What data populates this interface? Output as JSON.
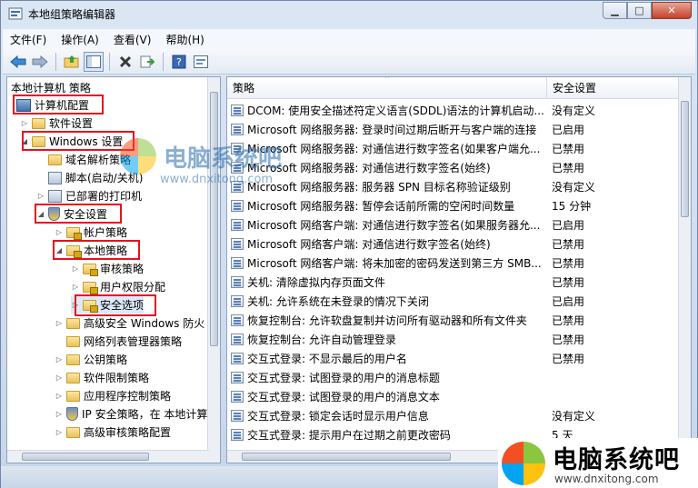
{
  "window": {
    "title": "本地组策略编辑器",
    "buttons": {
      "minimize": "▁",
      "maximize": "□",
      "close": "✕"
    }
  },
  "menu": [
    "文件(F)",
    "操作(A)",
    "查看(V)",
    "帮助(H)"
  ],
  "toolbar_icons": [
    "back-arrow-icon",
    "forward-arrow-icon",
    "up-folder-icon",
    "show-hide-tree-icon",
    "delete-icon",
    "export-list-icon",
    "help-icon",
    "properties-icon"
  ],
  "tree": {
    "root": "本地计算机 策略",
    "items": [
      {
        "label": "计算机配置",
        "level": 0,
        "icon": "computer-icon",
        "expanded": true,
        "highlight": true
      },
      {
        "label": "软件设置",
        "level": 1,
        "icon": "folder-icon",
        "expanded": false
      },
      {
        "label": "Windows 设置",
        "level": 1,
        "icon": "folder-icon",
        "expanded": true,
        "highlight": true
      },
      {
        "label": "域名解析策略",
        "level": 2,
        "icon": "folder-icon",
        "expanded": false
      },
      {
        "label": "脚本(启动/关机)",
        "level": 2,
        "icon": "script-icon",
        "expanded": null
      },
      {
        "label": "已部署的打印机",
        "level": 2,
        "icon": "printer-icon",
        "expanded": false
      },
      {
        "label": "安全设置",
        "level": 2,
        "icon": "security-icon",
        "expanded": true,
        "highlight": true
      },
      {
        "label": "帐户策略",
        "level": 3,
        "icon": "folder-icon",
        "expanded": false
      },
      {
        "label": "本地策略",
        "level": 3,
        "icon": "folder-icon",
        "expanded": true,
        "highlight": true
      },
      {
        "label": "审核策略",
        "level": 4,
        "icon": "folder-icon",
        "expanded": false
      },
      {
        "label": "用户权限分配",
        "level": 4,
        "icon": "folder-icon",
        "expanded": false
      },
      {
        "label": "安全选项",
        "level": 4,
        "icon": "folder-icon",
        "expanded": false,
        "highlight": true,
        "selected": true
      },
      {
        "label": "高级安全 Windows 防火",
        "level": 3,
        "icon": "folder-icon",
        "expanded": false
      },
      {
        "label": "网络列表管理器策略",
        "level": 3,
        "icon": "folder-icon",
        "expanded": null
      },
      {
        "label": "公钥策略",
        "level": 3,
        "icon": "folder-icon",
        "expanded": false
      },
      {
        "label": "软件限制策略",
        "level": 3,
        "icon": "folder-icon",
        "expanded": false
      },
      {
        "label": "应用程序控制策略",
        "level": 3,
        "icon": "folder-icon",
        "expanded": false
      },
      {
        "label": "IP 安全策略，在 本地计算",
        "level": 3,
        "icon": "ip-security-icon",
        "expanded": false
      },
      {
        "label": "高级审核策略配置",
        "level": 3,
        "icon": "folder-icon",
        "expanded": false
      }
    ]
  },
  "list": {
    "columns": {
      "policy": "策略",
      "setting": "安全设置"
    },
    "rows": [
      {
        "policy": "DCOM: 使用安全描述符定义语言(SDDL)语法的计算机启动...",
        "setting": "没有定义"
      },
      {
        "policy": "Microsoft 网络服务器: 登录时间过期后断开与客户端的连接",
        "setting": "已启用"
      },
      {
        "policy": "Microsoft 网络服务器: 对通信进行数字签名(如果客户端允...",
        "setting": "已禁用"
      },
      {
        "policy": "Microsoft 网络服务器: 对通信进行数字签名(始终)",
        "setting": "已禁用"
      },
      {
        "policy": "Microsoft 网络服务器: 服务器 SPN 目标名称验证级别",
        "setting": "没有定义"
      },
      {
        "policy": "Microsoft 网络服务器: 暂停会话前所需的空闲时间数量",
        "setting": "15 分钟"
      },
      {
        "policy": "Microsoft 网络客户端: 对通信进行数字签名(如果服务器允...",
        "setting": "已启用"
      },
      {
        "policy": "Microsoft 网络客户端: 对通信进行数字签名(始终)",
        "setting": "已禁用"
      },
      {
        "policy": "Microsoft 网络客户端: 将未加密的密码发送到第三方 SMB...",
        "setting": "已禁用"
      },
      {
        "policy": "关机: 清除虚拟内存页面文件",
        "setting": "已禁用"
      },
      {
        "policy": "关机: 允许系统在未登录的情况下关闭",
        "setting": "已启用"
      },
      {
        "policy": "恢复控制台: 允许软盘复制并访问所有驱动器和所有文件夹",
        "setting": "已禁用"
      },
      {
        "policy": "恢复控制台: 允许自动管理登录",
        "setting": "已禁用"
      },
      {
        "policy": "交互式登录: 不显示最后的用户名",
        "setting": "已禁用"
      },
      {
        "policy": "交互式登录: 试图登录的用户的消息标题",
        "setting": ""
      },
      {
        "policy": "交互式登录: 试图登录的用户的消息文本",
        "setting": ""
      },
      {
        "policy": "交互式登录: 锁定会话时显示用户信息",
        "setting": "没有定义"
      },
      {
        "policy": "交互式登录: 提示用户在过期之前更改密码",
        "setting": "5 天"
      }
    ]
  },
  "watermark": {
    "text": "电脑系统吧",
    "url": "www.dnxitong.com"
  },
  "logo": {
    "text": "电脑系统吧",
    "url": "www.dnxitong.com"
  },
  "colors": {
    "highlight_box": "#e8101e",
    "selected_bg": "#dce9f8"
  }
}
